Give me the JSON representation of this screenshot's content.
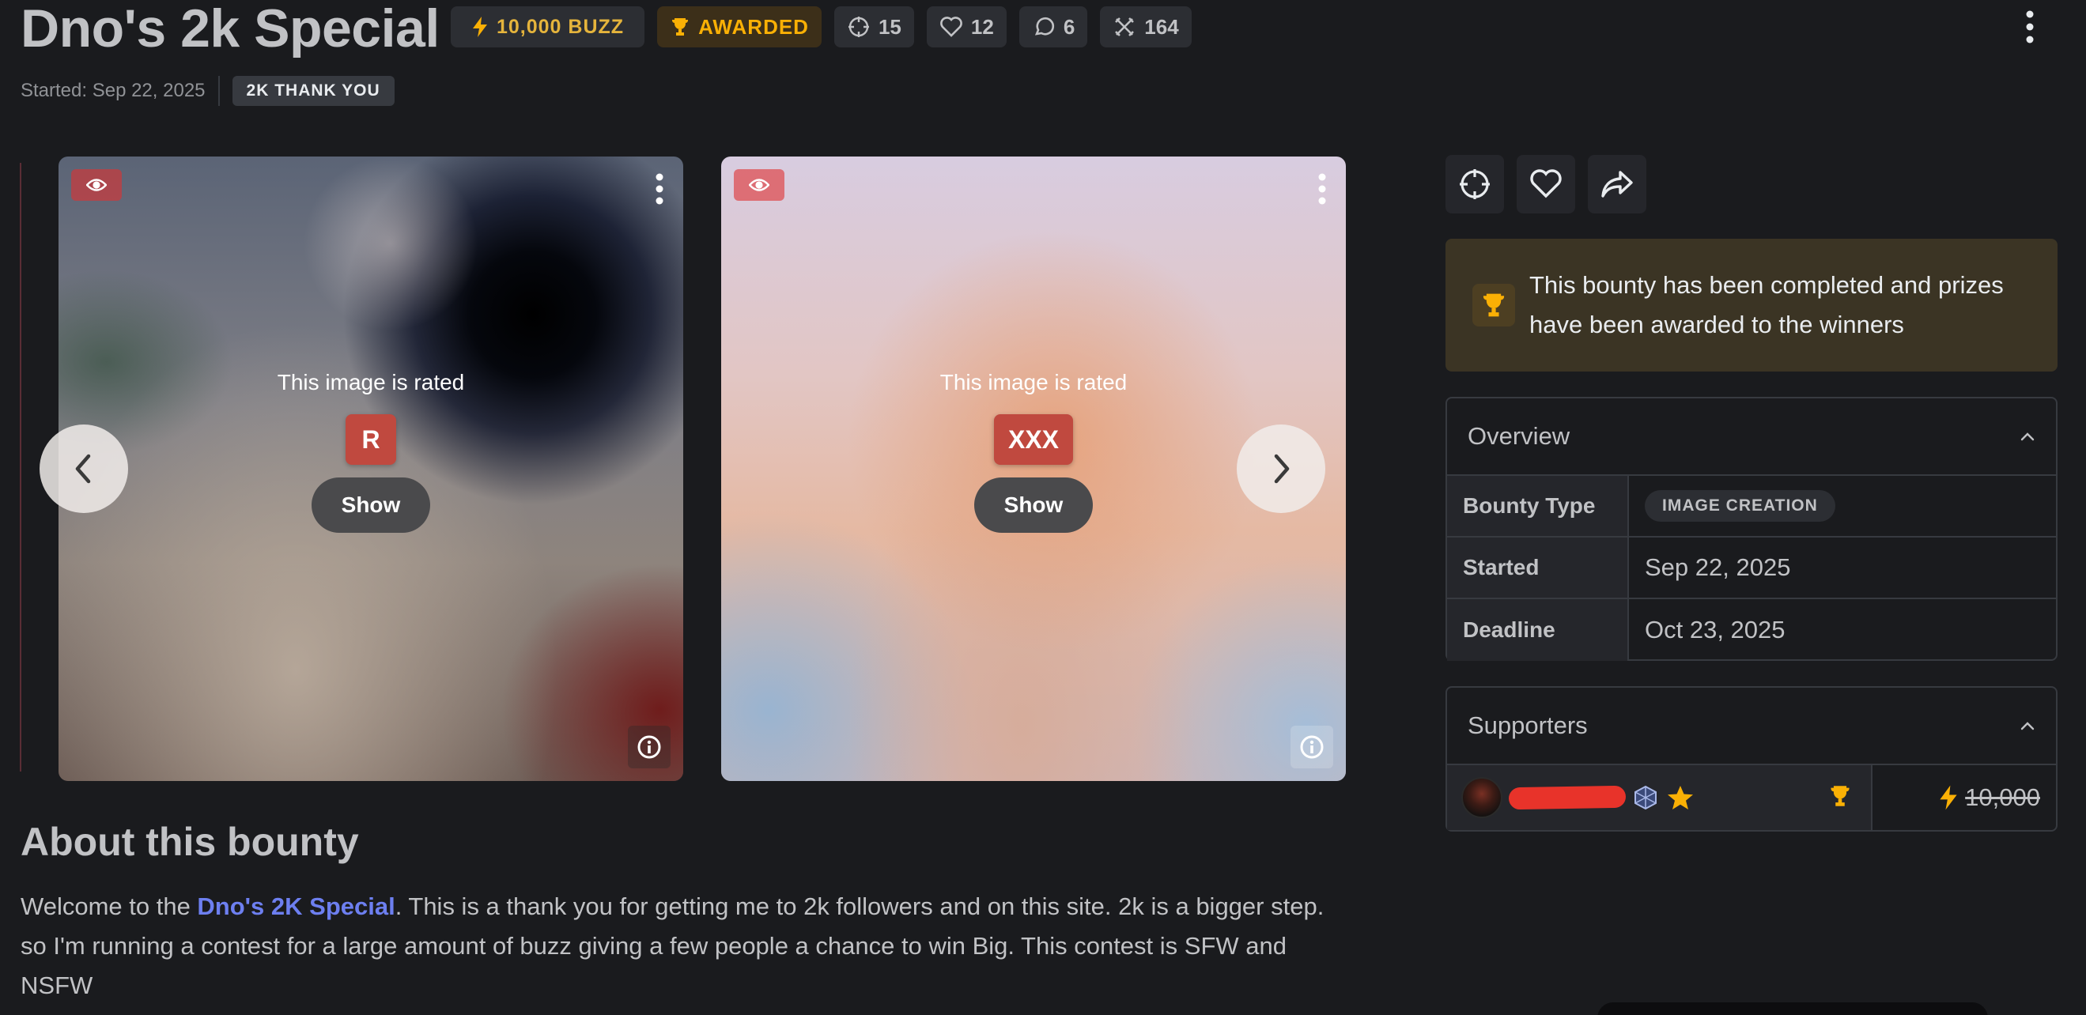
{
  "header": {
    "title": "Dno's 2k Special",
    "chips": {
      "buzz": "10,000 BUZZ",
      "awarded": "AWARDED",
      "entries": "15",
      "likes": "12",
      "comments": "6",
      "tips": "164"
    },
    "started": "Started: Sep 22, 2025",
    "tag": "2K THANK YOU"
  },
  "carousel": {
    "images": [
      {
        "rated_text": "This image is rated",
        "rating": "R",
        "show_label": "Show"
      },
      {
        "rated_text": "This image is rated",
        "rating": "XXX",
        "show_label": "Show"
      }
    ]
  },
  "about": {
    "title": "About this bounty",
    "text_pre": "Welcome to the ",
    "link": "Dno's 2K Special",
    "text_post": ". This is a thank you for getting me to 2k followers and on this site. 2k is a bigger step. so I'm running a contest for a large amount of buzz giving a few people a chance to win Big. This contest is SFW and NSFW"
  },
  "sidebar": {
    "alert": "This bounty has been completed and prizes have been awarded to the winners",
    "overview": {
      "title": "Overview",
      "rows": [
        {
          "key": "Bounty Type",
          "value": "IMAGE CREATION"
        },
        {
          "key": "Started",
          "value": "Sep 22, 2025"
        },
        {
          "key": "Deadline",
          "value": "Oct 23, 2025"
        }
      ]
    },
    "supporters": {
      "title": "Supporters",
      "amount": "10,000"
    }
  },
  "colors": {
    "background": "#1a1b1e",
    "buzz": "#fab005",
    "link": "#6d7ff0",
    "rating_badge": "#c0493f"
  },
  "icons": {
    "buzz": "lightning-icon",
    "awarded": "trophy-icon",
    "entries": "crosshair-icon",
    "likes": "heart-icon",
    "comments": "comment-icon",
    "tips": "tip-icon"
  }
}
